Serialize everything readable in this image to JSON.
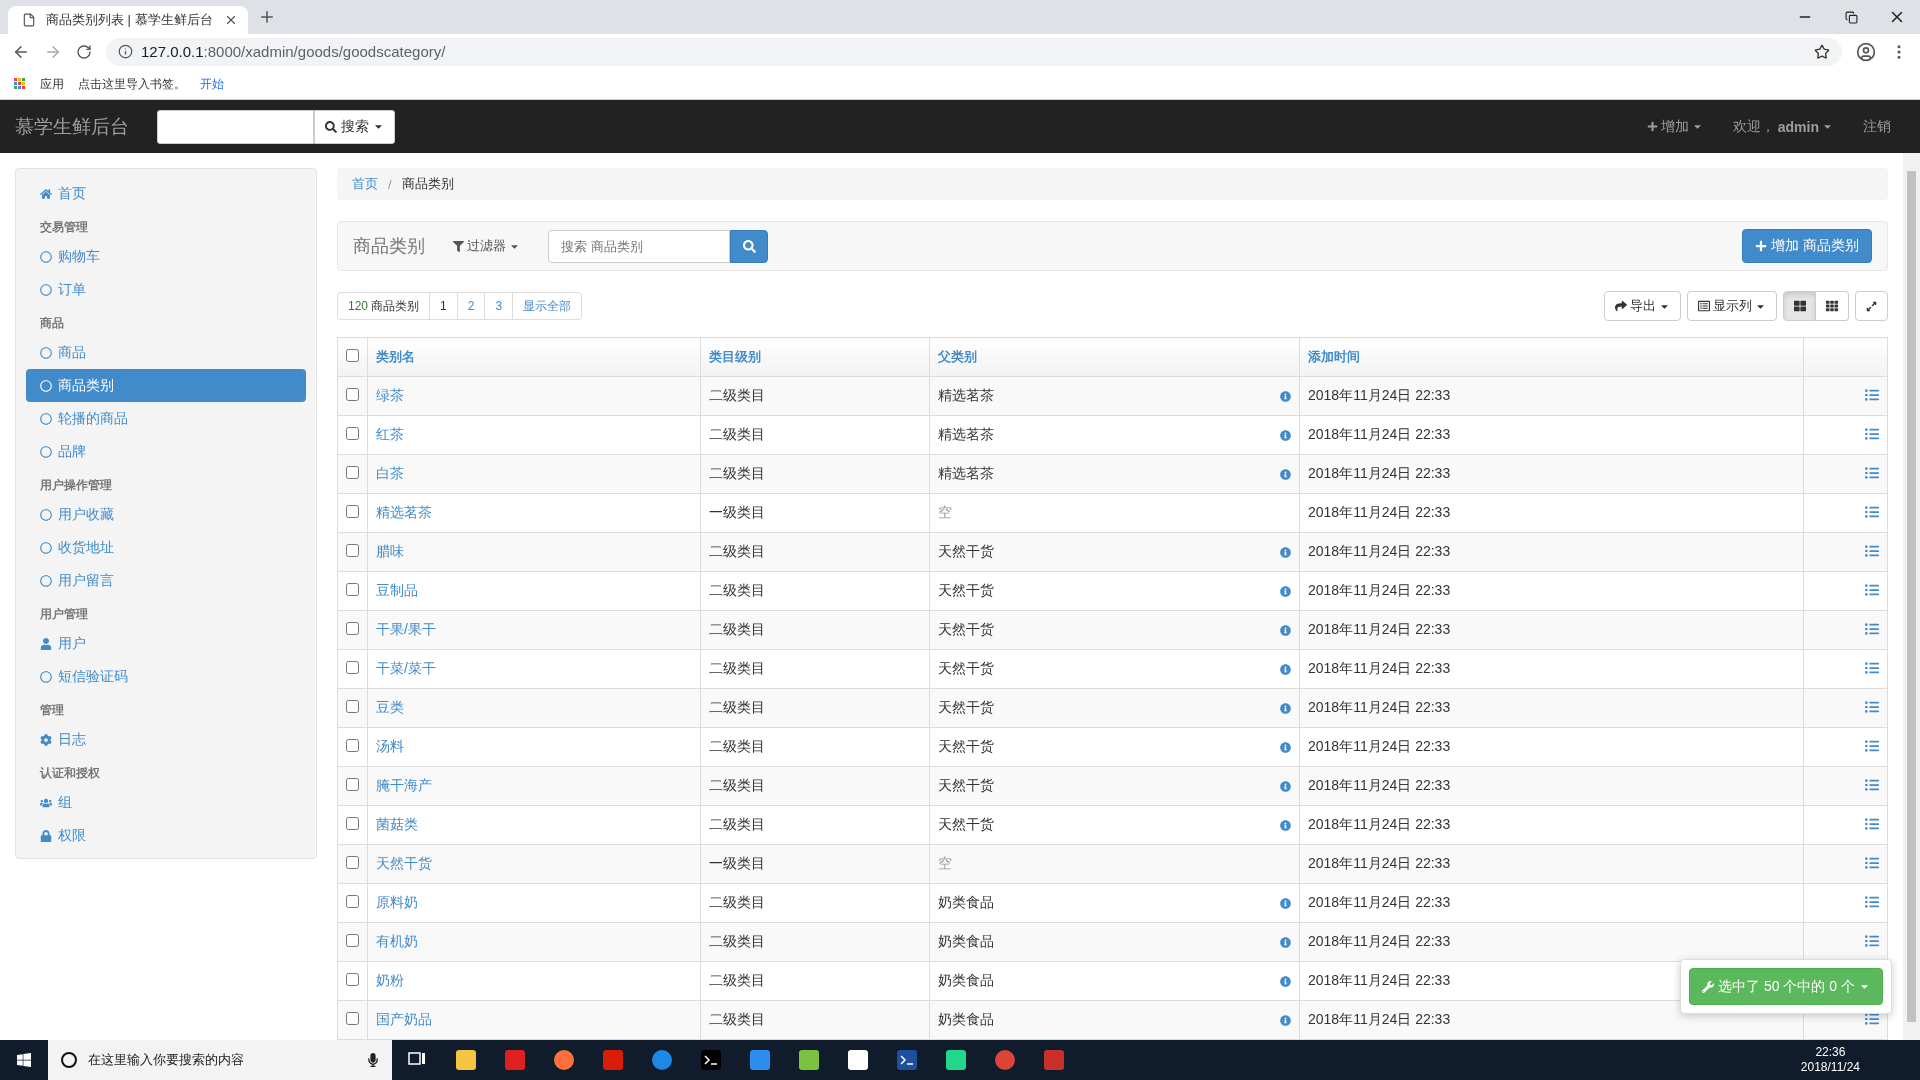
{
  "browser": {
    "tab_title": "商品类别列表 | 慕学生鲜后台",
    "url_host": "127.0.0.1",
    "url_path": ":8000/xadmin/goods/goodscategory/",
    "bookmarks": [
      {
        "label": "应用",
        "kind": "plain"
      },
      {
        "label": "点击这里导入书签。",
        "kind": "plain"
      },
      {
        "label": "开始",
        "kind": "link"
      }
    ]
  },
  "navbar": {
    "brand": "慕学生鲜后台",
    "search_button": "搜索",
    "add_menu": "增加",
    "welcome": "欢迎，",
    "user": "admin",
    "logout": "注销"
  },
  "sidebar": {
    "items": [
      {
        "kind": "home",
        "label": "首页",
        "selected": false
      },
      {
        "kind": "section",
        "label": "交易管理"
      },
      {
        "kind": "link",
        "label": "购物车",
        "selected": false
      },
      {
        "kind": "link",
        "label": "订单",
        "selected": false
      },
      {
        "kind": "section",
        "label": "商品"
      },
      {
        "kind": "link",
        "label": "商品",
        "selected": false
      },
      {
        "kind": "link",
        "label": "商品类别",
        "selected": true
      },
      {
        "kind": "link",
        "label": "轮播的商品",
        "selected": false
      },
      {
        "kind": "link",
        "label": "品牌",
        "selected": false
      },
      {
        "kind": "section",
        "label": "用户操作管理"
      },
      {
        "kind": "link",
        "label": "用户收藏",
        "selected": false
      },
      {
        "kind": "link",
        "label": "收货地址",
        "selected": false
      },
      {
        "kind": "link",
        "label": "用户留言",
        "selected": false
      },
      {
        "kind": "section",
        "label": "用户管理"
      },
      {
        "kind": "user",
        "label": "用户",
        "selected": false
      },
      {
        "kind": "link",
        "label": "短信验证码",
        "selected": false
      },
      {
        "kind": "section",
        "label": "管理"
      },
      {
        "kind": "settings",
        "label": "日志",
        "selected": false
      },
      {
        "kind": "section",
        "label": "认证和授权"
      },
      {
        "kind": "group",
        "label": "组",
        "selected": false
      },
      {
        "kind": "lock",
        "label": "权限",
        "selected": false
      }
    ]
  },
  "breadcrumb": {
    "separator": "/",
    "items": [
      {
        "label": "首页",
        "kind": "link"
      },
      {
        "label": "商品类别",
        "kind": "current"
      }
    ]
  },
  "toolbar": {
    "title": "商品类别",
    "filter": "过滤器",
    "search_placeholder": "搜索 商品类别",
    "add_button": "增加 商品类别"
  },
  "pagination": {
    "count": "120",
    "count_label": "商品类别",
    "pages": [
      {
        "label": "1",
        "selected": true
      },
      {
        "label": "2",
        "selected": false
      },
      {
        "label": "3",
        "selected": false
      }
    ],
    "show_all": "显示全部"
  },
  "actions": {
    "export": "导出",
    "columns": "显示列",
    "views": [
      {
        "kind": "large-grid",
        "selected": true
      },
      {
        "kind": "small-grid",
        "selected": false
      }
    ]
  },
  "table": {
    "all_checked": false,
    "columns": [
      "类别名",
      "类目级别",
      "父类别",
      "添加时间"
    ],
    "rows": [
      {
        "name": "绿茶",
        "level": "二级类目",
        "parent": "精选茗茶",
        "has_parent": true,
        "time": "2018年11月24日 22:33",
        "checked": false
      },
      {
        "name": "红茶",
        "level": "二级类目",
        "parent": "精选茗茶",
        "has_parent": true,
        "time": "2018年11月24日 22:33",
        "checked": false
      },
      {
        "name": "白茶",
        "level": "二级类目",
        "parent": "精选茗茶",
        "has_parent": true,
        "time": "2018年11月24日 22:33",
        "checked": false
      },
      {
        "name": "精选茗茶",
        "level": "一级类目",
        "parent": "空",
        "has_parent": false,
        "time": "2018年11月24日 22:33",
        "checked": false
      },
      {
        "name": "腊味",
        "level": "二级类目",
        "parent": "天然干货",
        "has_parent": true,
        "time": "2018年11月24日 22:33",
        "checked": false
      },
      {
        "name": "豆制品",
        "level": "二级类目",
        "parent": "天然干货",
        "has_parent": true,
        "time": "2018年11月24日 22:33",
        "checked": false
      },
      {
        "name": "干果/果干",
        "level": "二级类目",
        "parent": "天然干货",
        "has_parent": true,
        "time": "2018年11月24日 22:33",
        "checked": false
      },
      {
        "name": "干菜/菜干",
        "level": "二级类目",
        "parent": "天然干货",
        "has_parent": true,
        "time": "2018年11月24日 22:33",
        "checked": false
      },
      {
        "name": "豆类",
        "level": "二级类目",
        "parent": "天然干货",
        "has_parent": true,
        "time": "2018年11月24日 22:33",
        "checked": false
      },
      {
        "name": "汤料",
        "level": "二级类目",
        "parent": "天然干货",
        "has_parent": true,
        "time": "2018年11月24日 22:33",
        "checked": false
      },
      {
        "name": "腌干海产",
        "level": "二级类目",
        "parent": "天然干货",
        "has_parent": true,
        "time": "2018年11月24日 22:33",
        "checked": false
      },
      {
        "name": "菌菇类",
        "level": "二级类目",
        "parent": "天然干货",
        "has_parent": true,
        "time": "2018年11月24日 22:33",
        "checked": false
      },
      {
        "name": "天然干货",
        "level": "一级类目",
        "parent": "空",
        "has_parent": false,
        "time": "2018年11月24日 22:33",
        "checked": false
      },
      {
        "name": "原料奶",
        "level": "二级类目",
        "parent": "奶类食品",
        "has_parent": true,
        "time": "2018年11月24日 22:33",
        "checked": false
      },
      {
        "name": "有机奶",
        "level": "二级类目",
        "parent": "奶类食品",
        "has_parent": true,
        "time": "2018年11月24日 22:33",
        "checked": false
      },
      {
        "name": "奶粉",
        "level": "二级类目",
        "parent": "奶类食品",
        "has_parent": true,
        "time": "2018年11月24日 22:33",
        "checked": false
      },
      {
        "name": "国产奶品",
        "level": "二级类目",
        "parent": "奶类食品",
        "has_parent": true,
        "time": "2018年11月24日 22:33",
        "checked": false
      }
    ]
  },
  "selection_bar": "选中了 50 个中的 0 个",
  "taskbar": {
    "search_placeholder": "在这里输入你要搜索的内容",
    "time": "22:36",
    "date": "2018/11/24"
  }
}
